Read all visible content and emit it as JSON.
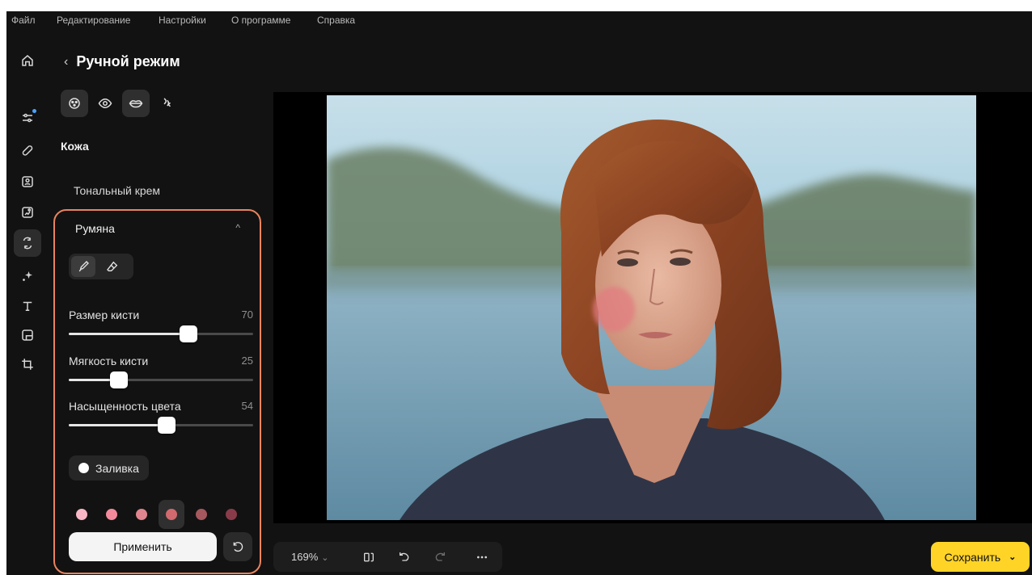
{
  "menu": [
    "Файл",
    "Редактирование",
    "Настройки",
    "О программе",
    "Справка"
  ],
  "rail": [
    {
      "icon": "home-icon"
    },
    {
      "icon": "sliders-icon",
      "badge": true
    },
    {
      "icon": "bandage-icon"
    },
    {
      "icon": "portrait-icon"
    },
    {
      "icon": "image-replace-icon"
    },
    {
      "icon": "retouch-icon",
      "active": true
    },
    {
      "icon": "sparkle-icon"
    },
    {
      "icon": "text-icon"
    },
    {
      "icon": "layers-icon"
    },
    {
      "icon": "crop-icon"
    }
  ],
  "panel": {
    "title": "Ручной режим",
    "back_glyph": "‹",
    "tools": [
      "face-tool-icon",
      "eye-tool-icon",
      "lips-tool-icon",
      "hair-tool-icon"
    ],
    "section": "Кожа",
    "foundation": "Тональный крем",
    "blush": {
      "title": "Румяна",
      "collapse_glyph": "^",
      "sliders": [
        {
          "label": "Размер кисти",
          "value": "70",
          "fraction": 0.65
        },
        {
          "label": "Мягкость кисти",
          "value": "25",
          "fraction": 0.27
        },
        {
          "label": "Насыщенность цвета",
          "value": "54",
          "fraction": 0.53
        }
      ],
      "fill_label": "Заливка",
      "swatches": [
        "#f7b7c5",
        "#f28a9c",
        "#e0848e",
        "#d06a6e",
        "#a6585f",
        "#8a3b4a"
      ],
      "active_swatch": 3,
      "apply_label": "Применить"
    }
  },
  "bottom": {
    "zoom": "169%",
    "zoom_chev": "⌄",
    "save_label": "Сохранить",
    "save_chev": "⌄"
  },
  "colors": {
    "accent_outline": "#e9845f",
    "save_button": "#ffd426",
    "background": "#121212"
  }
}
